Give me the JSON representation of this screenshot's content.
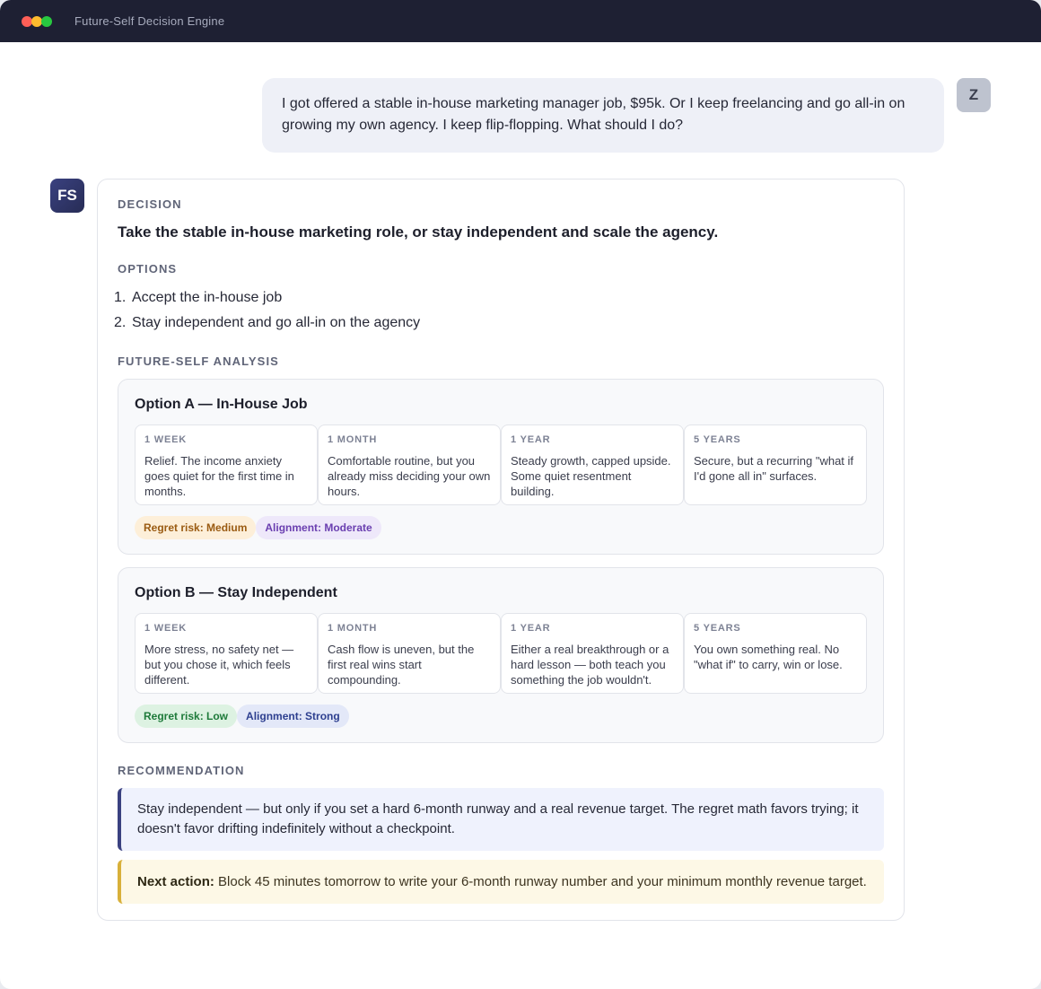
{
  "window": {
    "title": "Future-Self Decision Engine"
  },
  "user": {
    "avatar": "Z",
    "message": "I got offered a stable in-house marketing manager job, $95k. Or I keep freelancing and go all-in on growing my own agency. I keep flip-flopping. What should I do?"
  },
  "assistant": {
    "avatar": "FS",
    "decision_label": "DECISION",
    "decision": "Take the stable in-house marketing role, or stay independent and scale the agency.",
    "options_label": "OPTIONS",
    "options": [
      {
        "num": "1.",
        "text": "Accept the in-house job"
      },
      {
        "num": "2.",
        "text": "Stay independent and go all-in on the agency"
      }
    ],
    "analysis_label": "FUTURE-SELF ANALYSIS",
    "option_cards": [
      {
        "title": "Option A — In-House Job",
        "timeline": [
          {
            "label": "1 WEEK",
            "text": "Relief. The income anxiety goes quiet for the first time in months."
          },
          {
            "label": "1 MONTH",
            "text": "Comfortable routine, but you already miss deciding your own hours."
          },
          {
            "label": "1 YEAR",
            "text": "Steady growth, capped upside. Some quiet resentment building."
          },
          {
            "label": "5 YEARS",
            "text": "Secure, but a recurring \"what if I'd gone all in\" surfaces."
          }
        ],
        "regret": "Regret risk: Medium",
        "alignment": "Alignment: Moderate"
      },
      {
        "title": "Option B — Stay Independent",
        "timeline": [
          {
            "label": "1 WEEK",
            "text": "More stress, no safety net — but you chose it, which feels different."
          },
          {
            "label": "1 MONTH",
            "text": "Cash flow is uneven, but the first real wins start compounding."
          },
          {
            "label": "1 YEAR",
            "text": "Either a real breakthrough or a hard lesson — both teach you something the job wouldn't."
          },
          {
            "label": "5 YEARS",
            "text": "You own something real. No \"what if\" to carry, win or lose."
          }
        ],
        "regret": "Regret risk: Low",
        "alignment": "Alignment: Strong"
      }
    ],
    "recommendation_label": "RECOMMENDATION",
    "recommendation": "Stay independent — but only if you set a hard 6-month runway and a real revenue target. The regret math favors trying; it doesn't favor drifting indefinitely without a checkpoint.",
    "next_action_label": "Next action:",
    "next_action": "Block 45 minutes tomorrow to write your 6-month runway number and your minimum monthly revenue target."
  },
  "colors": {
    "titlebar": "#1e2033",
    "accent": "#3a4180",
    "regret_medium": "#9a5b12",
    "alignment_moderate": "#6a3fb0",
    "regret_low": "#1e7a3a",
    "alignment_strong": "#2d3f8f"
  }
}
